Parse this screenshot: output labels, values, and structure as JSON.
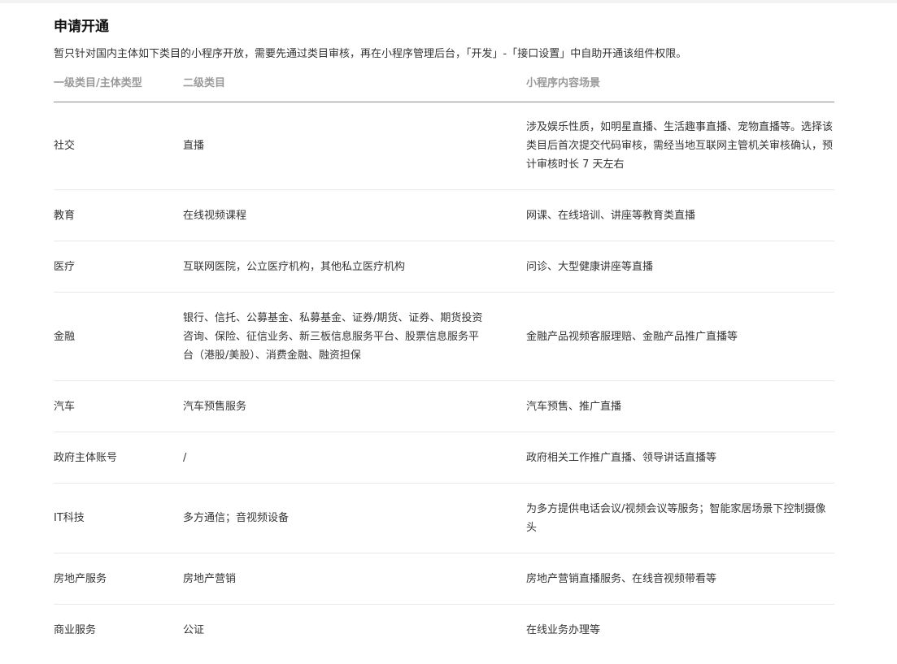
{
  "page": {
    "title": "申请开通",
    "description": "暂只针对国内主体如下类目的小程序开放，需要先通过类目审核，再在小程序管理后台，「开发」-「接口设置」中自助开通该组件权限。"
  },
  "table": {
    "headers": [
      "一级类目/主体类型",
      "二级类目",
      "小程序内容场景"
    ],
    "rows": [
      {
        "primary": "社交",
        "secondary": "直播",
        "scene": "涉及娱乐性质，如明星直播、生活趣事直播、宠物直播等。选择该类目后首次提交代码审核，需经当地互联网主管机关审核确认，预计审核时长 7 天左右"
      },
      {
        "primary": "教育",
        "secondary": "在线视频课程",
        "scene": "网课、在线培训、讲座等教育类直播"
      },
      {
        "primary": "医疗",
        "secondary": "互联网医院，公立医疗机构，其他私立医疗机构",
        "scene": "问诊、大型健康讲座等直播"
      },
      {
        "primary": "金融",
        "secondary": "银行、信托、公募基金、私募基金、证券/期货、证券、期货投资咨询、保险、征信业务、新三板信息服务平台、股票信息服务平台（港股/美股）、消费金融、融资担保",
        "scene": "金融产品视频客服理赔、金融产品推广直播等"
      },
      {
        "primary": "汽车",
        "secondary": "汽车预售服务",
        "scene": "汽车预售、推广直播"
      },
      {
        "primary": "政府主体账号",
        "secondary": "/",
        "scene": "政府相关工作推广直播、领导讲话直播等"
      },
      {
        "primary": "IT科技",
        "secondary": "多方通信；音视频设备",
        "scene": "为多方提供电话会议/视频会议等服务；智能家居场景下控制摄像头"
      },
      {
        "primary": "房地产服务",
        "secondary": "房地产营销",
        "scene": "房地产营销直播服务、在线音视频带看等"
      },
      {
        "primary": "商业服务",
        "secondary": "公证",
        "scene": "在线业务办理等"
      }
    ]
  }
}
